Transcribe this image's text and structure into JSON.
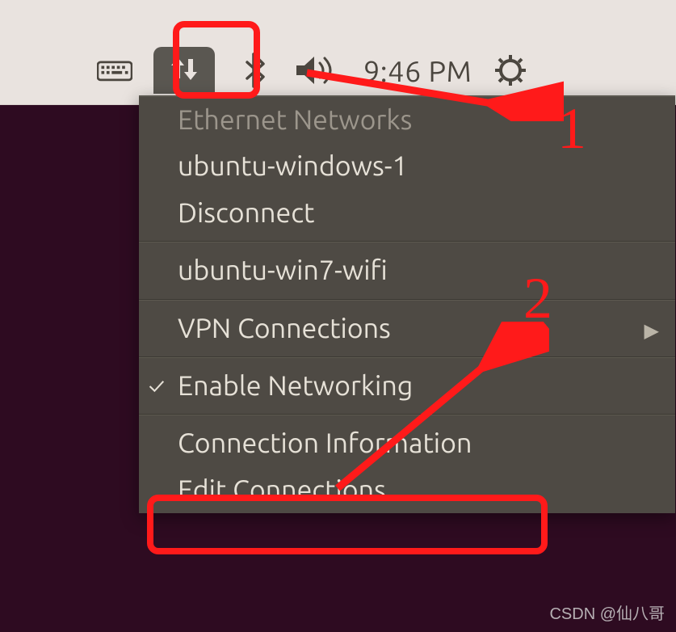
{
  "topbar": {
    "time": "9:46 PM"
  },
  "menu": {
    "header_ethernet": "Ethernet Networks",
    "conn_wired": "ubuntu-windows-1",
    "disconnect": "Disconnect",
    "conn_wifi": "ubuntu-win7-wifi",
    "vpn": "VPN Connections",
    "enable_networking": "Enable Networking",
    "conn_info": "Connection Information",
    "edit_connections": "Edit Connections..."
  },
  "annotations": {
    "label1": "1",
    "label2": "2"
  },
  "watermark": "CSDN @仙八哥"
}
